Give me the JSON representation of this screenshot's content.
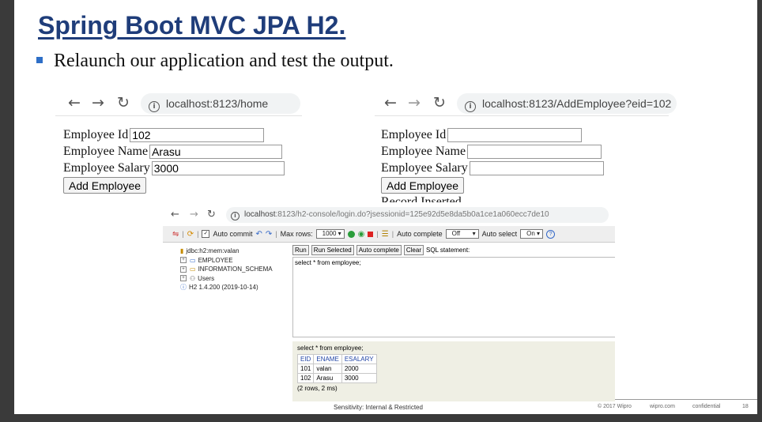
{
  "slide": {
    "title": "Spring Boot MVC JPA H2.",
    "bullet": "Relaunch our application and test the output."
  },
  "browser_left": {
    "url": "localhost:8123/home",
    "form": {
      "id_label": "Employee Id",
      "id_value": "102",
      "name_label": "Employee Name",
      "name_value": "Arasu",
      "salary_label": "Employee Salary",
      "salary_value": "3000",
      "submit_label": "Add Employee"
    }
  },
  "browser_right": {
    "url": "localhost:8123/AddEmployee?eid=102",
    "form": {
      "id_label": "Employee Id",
      "id_value": "",
      "name_label": "Employee Name",
      "name_value": "",
      "salary_label": "Employee Salary",
      "salary_value": "",
      "submit_label": "Add Employee",
      "message": "Record Inserted"
    }
  },
  "h2_console": {
    "url_host": "localhost",
    "url_rest": ":8123/h2-console/login.do?jsessionid=125e92d5e8da5b0a1ce1a060ecc7de10",
    "toolbar": {
      "auto_commit": "Auto commit",
      "max_rows_label": "Max rows:",
      "max_rows_value": "1000",
      "auto_complete_label": "Auto complete",
      "auto_complete_value": "Off",
      "auto_select_label": "Auto select",
      "auto_select_value": "On"
    },
    "tree": {
      "connection": "jdbc:h2:mem:valan",
      "items": [
        "EMPLOYEE",
        "INFORMATION_SCHEMA",
        "Users"
      ],
      "version": "H2 1.4.200 (2019-10-14)"
    },
    "sql_buttons": {
      "run": "Run",
      "run_selected": "Run Selected",
      "auto_complete": "Auto complete",
      "clear": "Clear",
      "statement_label": "SQL statement:"
    },
    "sql_text": "select * from employee;",
    "result": {
      "query": "select * from employee;",
      "columns": [
        "EID",
        "ENAME",
        "ESALARY"
      ],
      "rows": [
        [
          "101",
          "valan",
          "2000"
        ],
        [
          "102",
          "Arasu",
          "3000"
        ]
      ],
      "summary": "(2 rows, 2 ms)"
    }
  },
  "footer": {
    "sensitivity": "Sensitivity: Internal & Restricted",
    "copyright": "© 2017 Wipro",
    "site": "wipro.com",
    "confidential": "confidential",
    "page": "18"
  },
  "colors": {
    "title": "#1f3d7a",
    "bullet": "#2e6fc7",
    "table_header": "#2245a5"
  }
}
